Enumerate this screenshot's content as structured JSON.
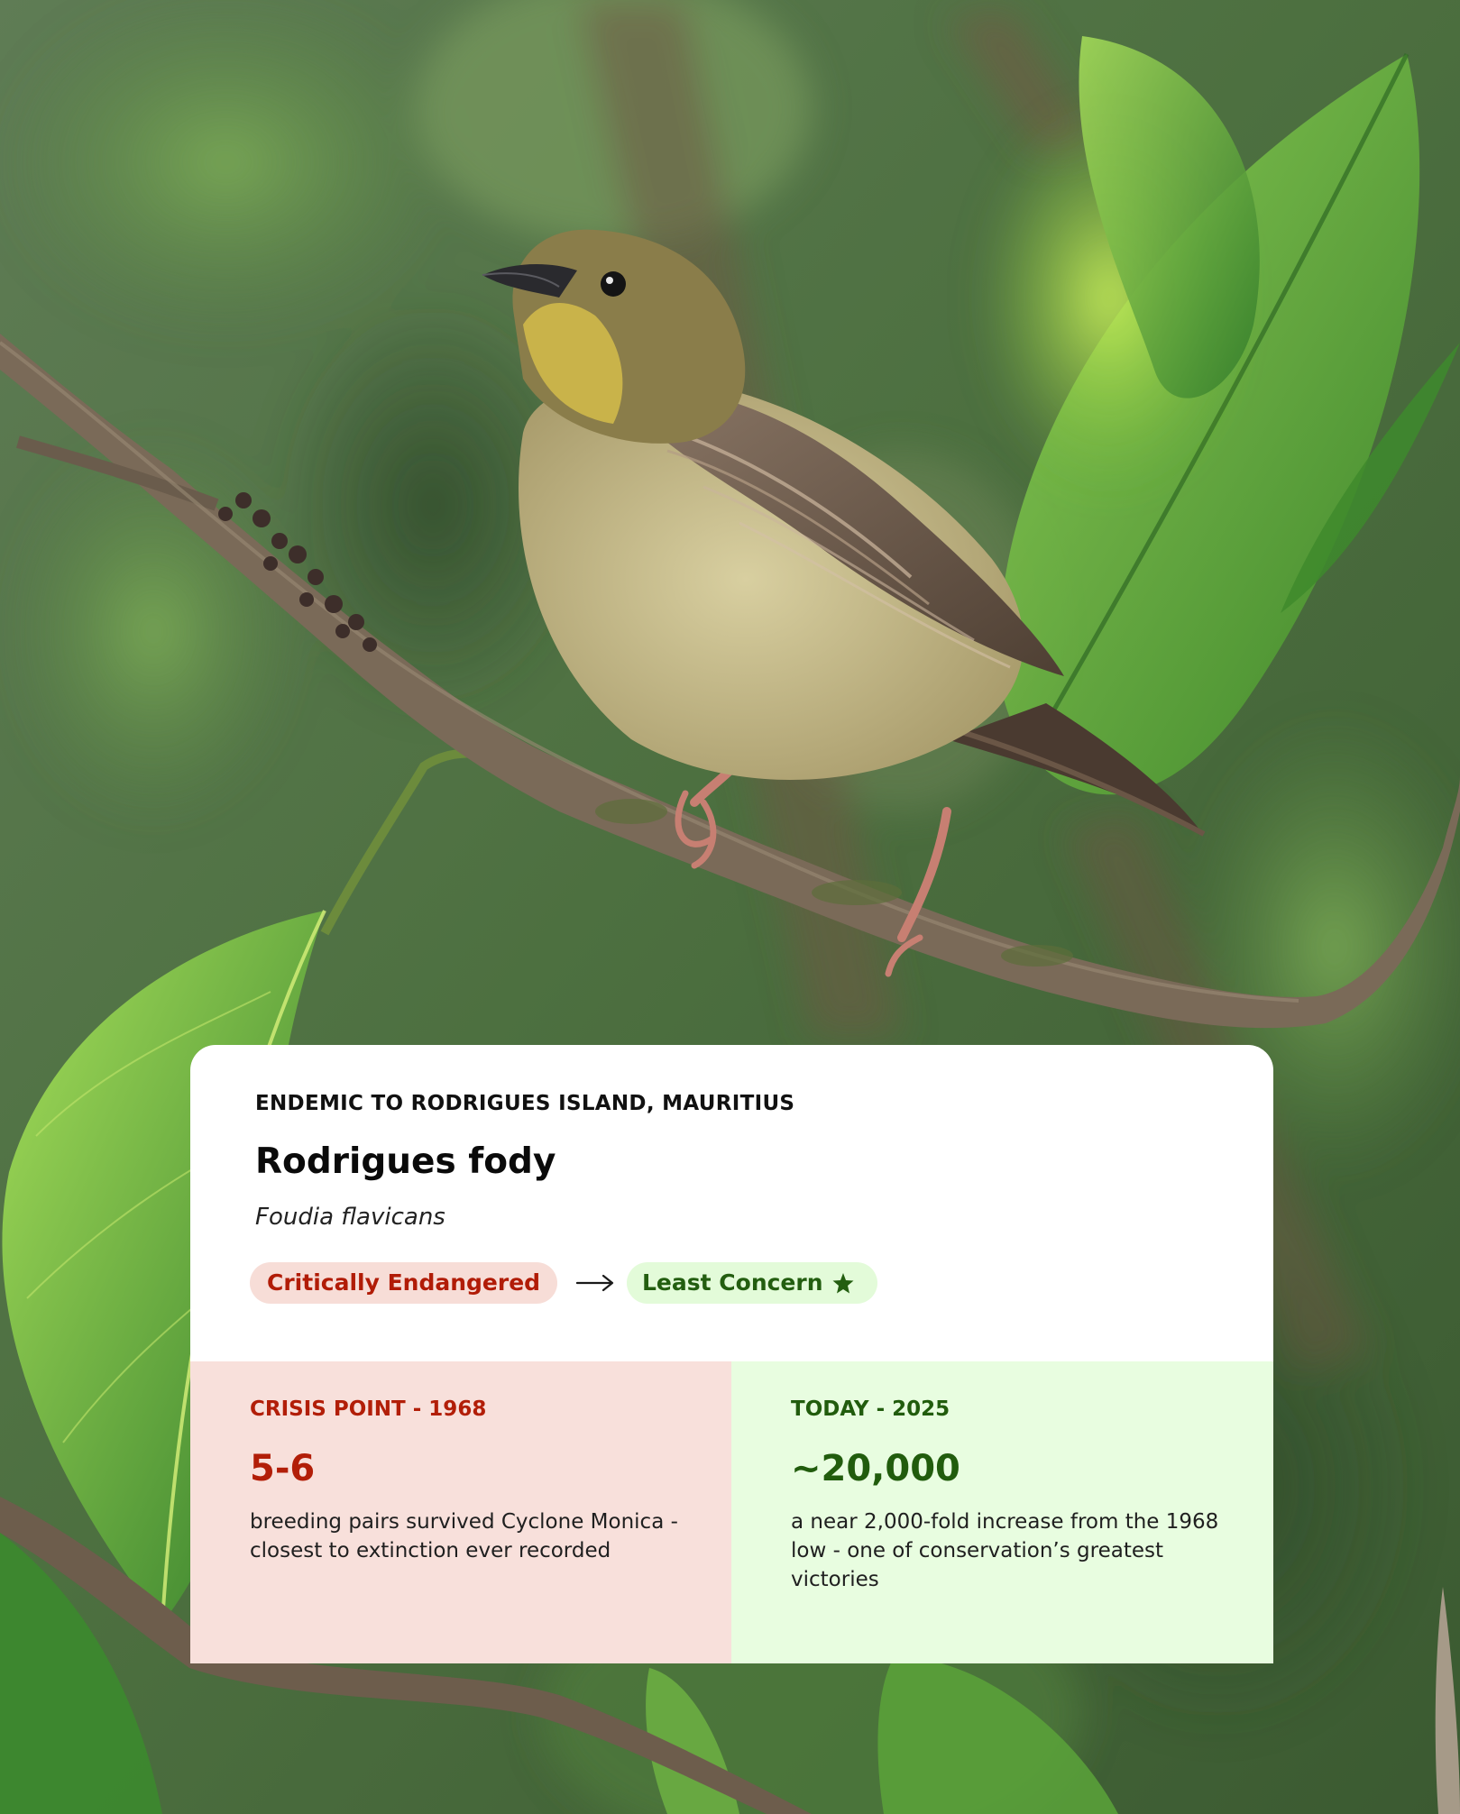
{
  "species_card": {
    "kicker": "ENDEMIC TO RODRIGUES ISLAND, MAURITIUS",
    "common_name": "Rodrigues fody",
    "scientific_name": "Foudia flavicans",
    "status_from": "Critically Endangered",
    "status_to": "Least Concern",
    "arrow_icon": "arrow-right-icon",
    "status_icon": "star-icon"
  },
  "crisis": {
    "label": "CRISIS POINT - 1968",
    "value": "5-6",
    "description": "breeding pairs survived Cyclone Monica - closest to extinction ever recorded"
  },
  "today": {
    "label": "TODAY - 2025",
    "value": "~20,000",
    "description": "a near 2,000-fold increase from the 1968 low - one of conservation’s greatest victories"
  },
  "colors": {
    "red_accent": "#b21e08",
    "red_background": "#f8e0db",
    "green_accent": "#215c0d",
    "green_background": "#e8fde0"
  }
}
